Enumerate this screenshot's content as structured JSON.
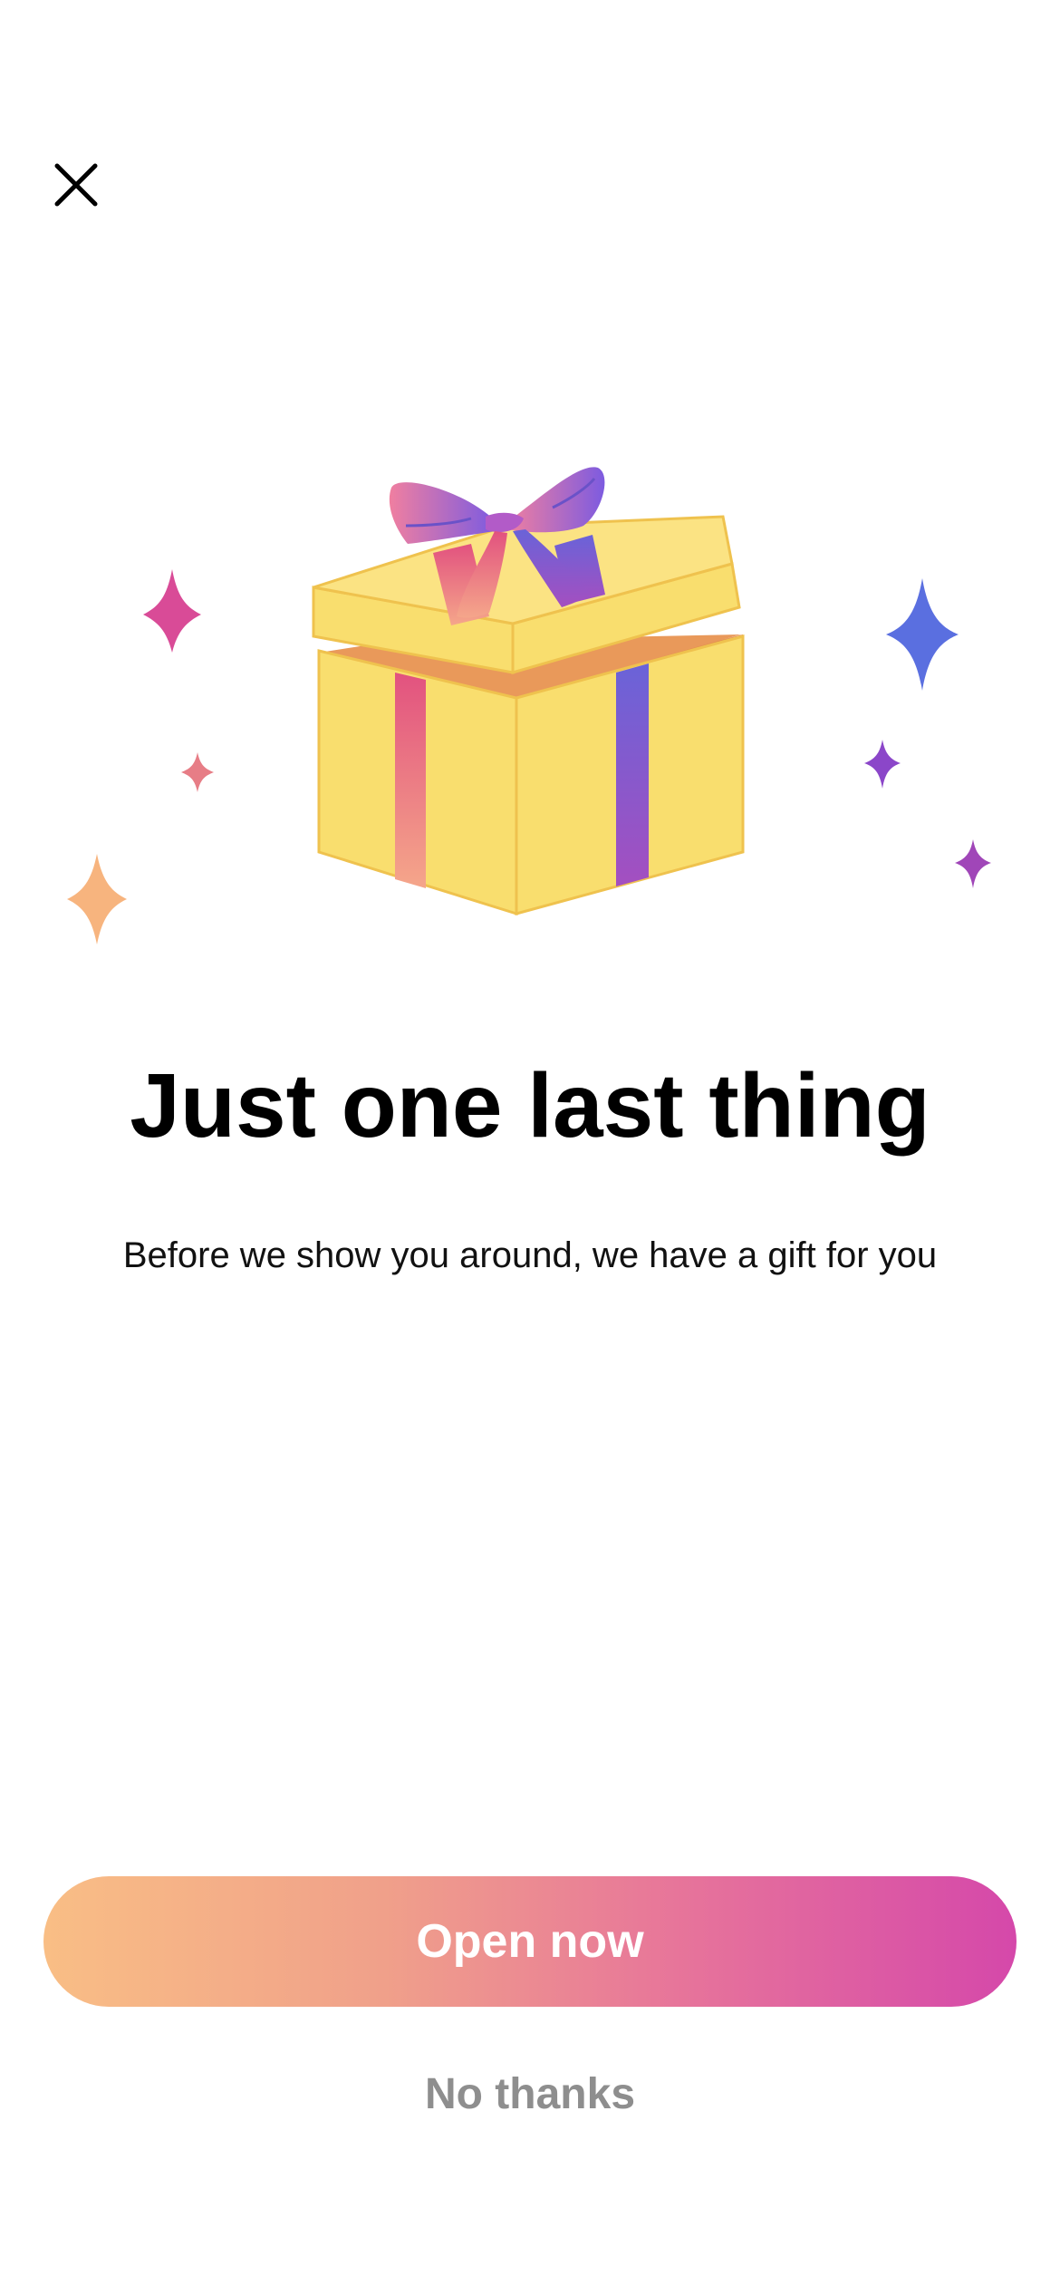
{
  "header": {
    "close_icon": "close-icon"
  },
  "illustration": {
    "icon": "gift-box-icon",
    "sparkle_icon": "sparkle-icon",
    "colors": {
      "box": "#F9DE6E",
      "box_edge": "#EFC24E",
      "box_inside": "#E38F4E",
      "ribbon_start": "#F07FA0",
      "ribbon_end": "#7D5BE0",
      "sparkle_pink": "#D94B97",
      "sparkle_blue": "#5A6FE0",
      "sparkle_purple": "#8B46C9",
      "sparkle_orange": "#F7B47E"
    }
  },
  "content": {
    "title": "Just one last thing",
    "subtitle": "Before we show you around, we have a gift for you"
  },
  "actions": {
    "primary_label": "Open now",
    "secondary_label": "No thanks",
    "primary_gradient": [
      "#F9BE85",
      "#D548AA"
    ],
    "secondary_color": "#8E8E8E"
  }
}
